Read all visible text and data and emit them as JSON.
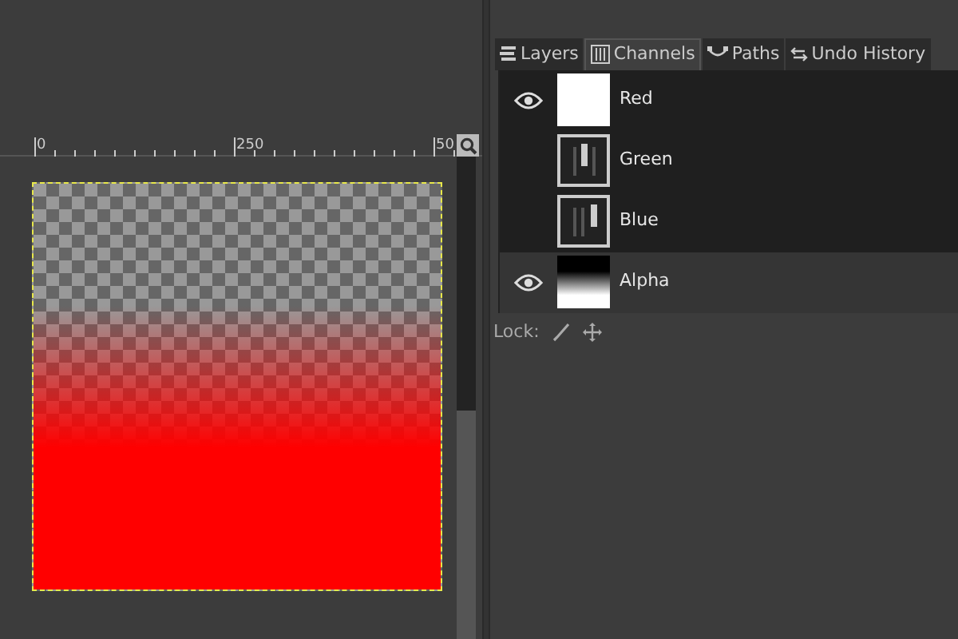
{
  "ruler": {
    "labels": [
      "0",
      "250",
      "50"
    ]
  },
  "tabs": [
    {
      "label": "Layers",
      "selected": false,
      "kind": "layers"
    },
    {
      "label": "Channels",
      "selected": true,
      "kind": "channels"
    },
    {
      "label": "Paths",
      "selected": false,
      "kind": "paths"
    },
    {
      "label": "Undo History",
      "selected": false,
      "kind": "undo"
    }
  ],
  "channels": [
    {
      "name": "Red",
      "visible": true,
      "selected": true,
      "kind": "solid"
    },
    {
      "name": "Green",
      "visible": false,
      "selected": true,
      "kind": "middle"
    },
    {
      "name": "Blue",
      "visible": false,
      "selected": true,
      "kind": "right"
    },
    {
      "name": "Alpha",
      "visible": true,
      "selected": false,
      "kind": "gradient"
    }
  ],
  "lock": {
    "label": "Lock:"
  }
}
